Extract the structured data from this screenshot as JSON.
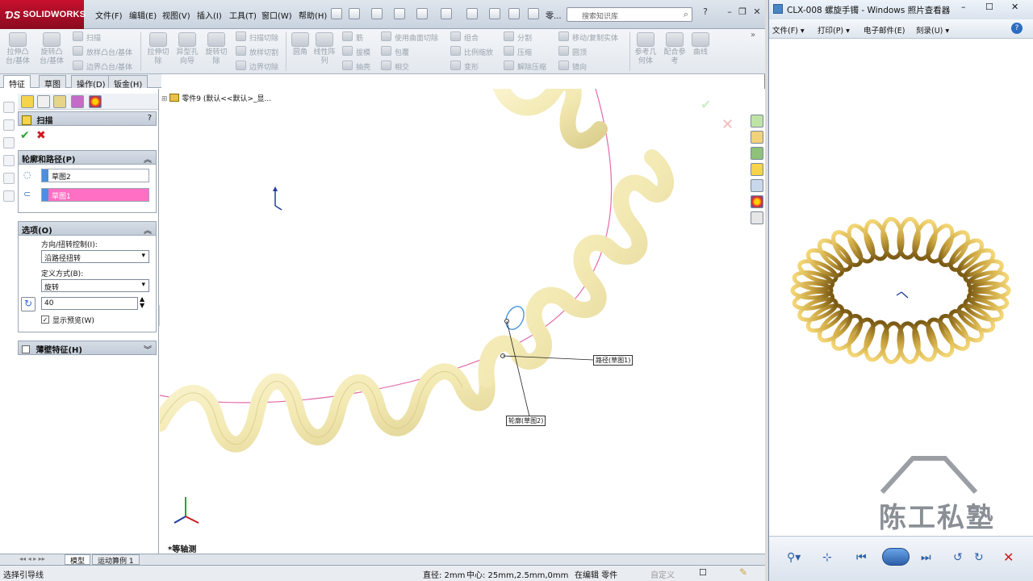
{
  "solidworks": {
    "brand": "SOLIDWORKS",
    "menus": [
      "文件(F)",
      "编辑(E)",
      "视图(V)",
      "插入(I)",
      "工具(T)",
      "窗口(W)",
      "帮助(H)"
    ],
    "part_short": "零...",
    "search_placeholder": "搜索知识库",
    "ribbon": {
      "big_buttons": [
        {
          "id": "extrude_boss",
          "label": "拉伸凸\n台/基体"
        },
        {
          "id": "revolve_boss",
          "label": "旋转凸\n台/基体"
        },
        {
          "id": "extrude_cut",
          "label": "拉伸切\n除"
        },
        {
          "id": "hole_wizard",
          "label": "异型孔\n向导"
        },
        {
          "id": "revolve_cut",
          "label": "旋转切\n除"
        },
        {
          "id": "fillet",
          "label": "圆角"
        },
        {
          "id": "linear_pattern",
          "label": "线性阵\n列"
        },
        {
          "id": "reference_geometry",
          "label": "参考几\n何体"
        },
        {
          "id": "mate_reference",
          "label": "配合参\n考"
        },
        {
          "id": "curves",
          "label": "曲线"
        }
      ],
      "small_buttons": [
        "扫描",
        "放样凸台/基体",
        "边界凸台/基体",
        "扫描切除",
        "放样切割",
        "边界切除",
        "筋",
        "拔模",
        "抽壳",
        "使用曲面切除",
        "包覆",
        "相交",
        "组合",
        "比例缩放",
        "变形",
        "分割",
        "压缩",
        "解除压缩",
        "移动/复制实体",
        "圆顶",
        "镜向"
      ]
    },
    "tabs": [
      "特征",
      "草图",
      "操作(D)",
      "钣金(H)"
    ],
    "active_tab": "特征",
    "property_manager": {
      "title": "扫描",
      "help": "?",
      "ok": "✔",
      "cancel": "✖",
      "profile_path": {
        "header": "轮廓和路径(P)",
        "profile": "草图2",
        "path": "草图1"
      },
      "options": {
        "header": "选项(O)",
        "orientation_label": "方向/扭转控制(I):",
        "orientation_value": "沿路径扭转",
        "define_label": "定义方式(B):",
        "define_value": "旋转",
        "turns_value": "40",
        "show_preview": "显示预览(W)",
        "show_preview_checked": true
      },
      "thin_feature": {
        "header": "薄壁特征(H)",
        "checked": false
      }
    },
    "feature_tree_root": "零件9  (默认<<默认>_显...",
    "callouts": {
      "path": "路径(草图1)",
      "profile": "轮廓(草图2)"
    },
    "view_label": "*等轴测",
    "bottom_tabs": [
      "模型",
      "运动算例 1"
    ],
    "status": {
      "left": "选择引导线",
      "diameter": "直径: 2mm",
      "center": "中心: 25mm,2.5mm,0mm",
      "editing": "在编辑 零件",
      "custom": "自定义"
    }
  },
  "viewer": {
    "title": "CLX-008 螺旋手镯 - Windows 照片查看器",
    "menus": [
      "文件(F) ▾",
      "打印(P) ▾",
      "电子邮件(E)",
      "刻录(U) ▾"
    ],
    "watermark": "陈工私塾",
    "colors": {
      "coil": "#c9a33f",
      "coil_dark": "#7a5a14"
    }
  }
}
